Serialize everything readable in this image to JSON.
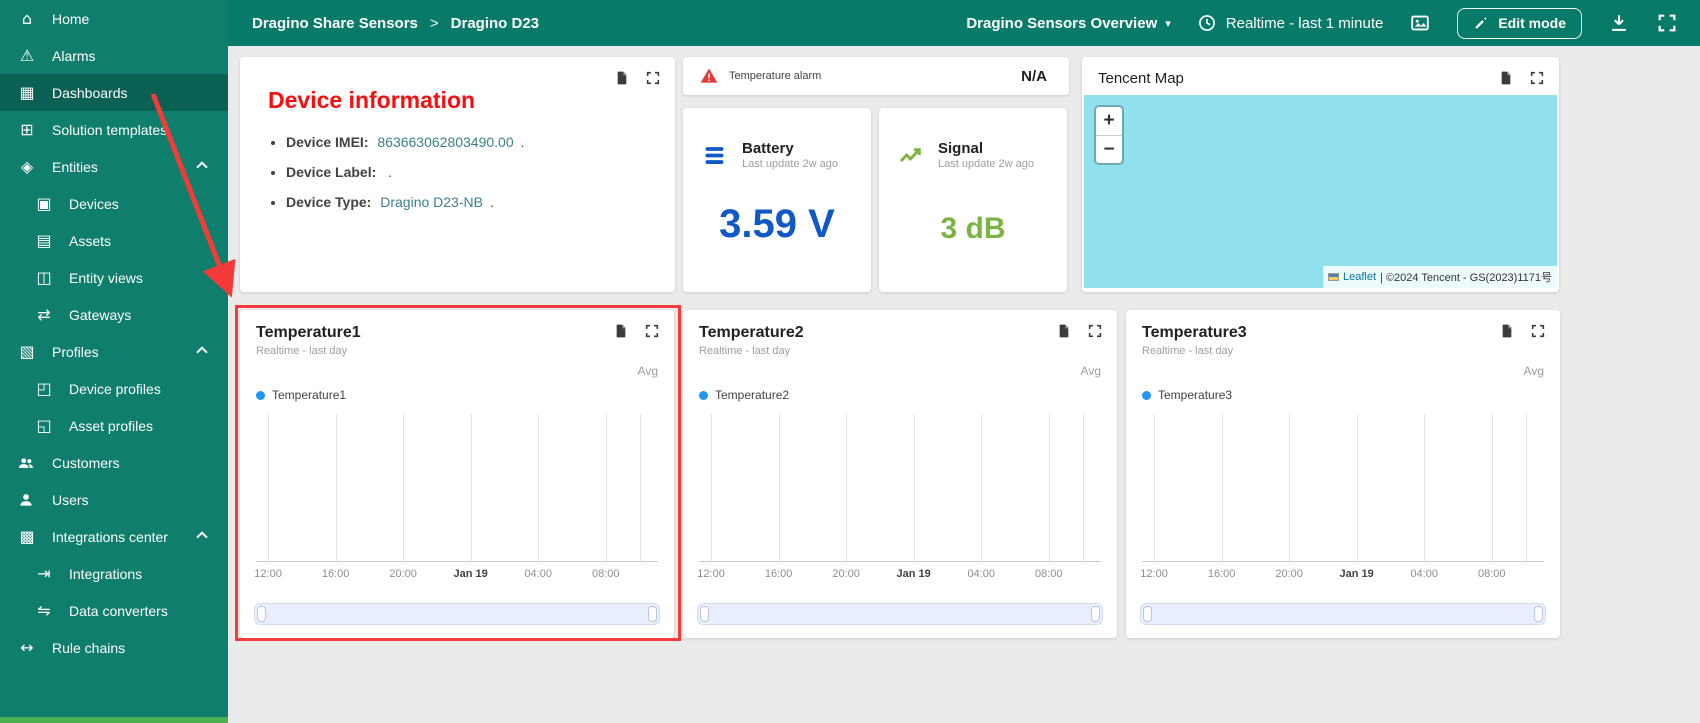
{
  "colors": {
    "sidebar_bg": "#0f7e6d",
    "sidebar_active_bg": "#0a6053",
    "header_bg": "#087a6a",
    "annotation_red": "#f43b3a",
    "device_info_title_red": "#f50f0f",
    "entity_link_teal": "#3d8087",
    "battery_value_blue": "#1158c7",
    "signal_value_green": "#7cb342",
    "alarm_icon_red": "#e53935",
    "map_water_cyan": "#90e0ee",
    "legend_dot_blue": "#2196f3",
    "scroll_strip_green": "#4caf50"
  },
  "sidebar": {
    "items": [
      {
        "label": "Home",
        "icon": "home-icon"
      },
      {
        "label": "Alarms",
        "icon": "alarms-icon"
      },
      {
        "label": "Dashboards",
        "icon": "dashboards-icon",
        "active": true
      },
      {
        "label": "Solution templates",
        "icon": "solution-templates-icon"
      },
      {
        "label": "Entities",
        "icon": "entities-icon",
        "expanded": true
      },
      {
        "label": "Devices",
        "icon": "devices-icon",
        "child": true
      },
      {
        "label": "Assets",
        "icon": "assets-icon",
        "child": true
      },
      {
        "label": "Entity views",
        "icon": "entity-views-icon",
        "child": true
      },
      {
        "label": "Gateways",
        "icon": "gateways-icon",
        "child": true
      },
      {
        "label": "Profiles",
        "icon": "profiles-icon",
        "expanded": true
      },
      {
        "label": "Device profiles",
        "icon": "device-profiles-icon",
        "child": true
      },
      {
        "label": "Asset profiles",
        "icon": "asset-profiles-icon",
        "child": true
      },
      {
        "label": "Customers",
        "icon": "customers-icon"
      },
      {
        "label": "Users",
        "icon": "users-icon"
      },
      {
        "label": "Integrations center",
        "icon": "integrations-center-icon",
        "expanded": true
      },
      {
        "label": "Integrations",
        "icon": "integrations-icon",
        "child": true
      },
      {
        "label": "Data converters",
        "icon": "data-converters-icon",
        "child": true
      },
      {
        "label": "Rule chains",
        "icon": "rule-chains-icon"
      }
    ]
  },
  "header": {
    "breadcrumb": [
      "Dragino Share Sensors",
      "Dragino D23"
    ],
    "breadcrumb_separator": ">",
    "dashboard_select": "Dragino Sensors Overview",
    "time_window": "Realtime - last 1 minute",
    "edit_mode_label": "Edit mode"
  },
  "cards": {
    "device_info": {
      "title": "Device information",
      "rows": [
        {
          "label": "Device IMEI:",
          "value": "863663062803490.00",
          "suffix": "."
        },
        {
          "label": "Device Label:",
          "value": "",
          "suffix": "."
        },
        {
          "label": "Device Type:",
          "value": "Dragino D23-NB",
          "suffix": "."
        }
      ]
    },
    "alarm": {
      "label": "Temperature alarm",
      "value": "N/A"
    },
    "battery": {
      "title": "Battery",
      "subtitle": "Last update 2w ago",
      "value": "3.59 V"
    },
    "signal": {
      "title": "Signal",
      "subtitle": "Last update 2w ago",
      "value": "3 dB"
    },
    "map": {
      "title": "Tencent Map",
      "zoom_in": "+",
      "zoom_out": "−",
      "attribution_link": "Leaflet",
      "attribution_text": "| ©2024 Tencent - GS(2023)1171号"
    },
    "temperature_charts": [
      {
        "title": "Temperature1",
        "subtitle": "Realtime - last day",
        "agg": "Avg",
        "legend": "Temperature1",
        "x_ticks": [
          "12:00",
          "16:00",
          "20:00",
          "Jan 19",
          "04:00",
          "08:00"
        ]
      },
      {
        "title": "Temperature2",
        "subtitle": "Realtime - last day",
        "agg": "Avg",
        "legend": "Temperature2",
        "x_ticks": [
          "12:00",
          "16:00",
          "20:00",
          "Jan 19",
          "04:00",
          "08:00"
        ]
      },
      {
        "title": "Temperature3",
        "subtitle": "Realtime - last day",
        "agg": "Avg",
        "legend": "Temperature3",
        "x_ticks": [
          "12:00",
          "16:00",
          "20:00",
          "Jan 19",
          "04:00",
          "08:00"
        ]
      }
    ]
  }
}
